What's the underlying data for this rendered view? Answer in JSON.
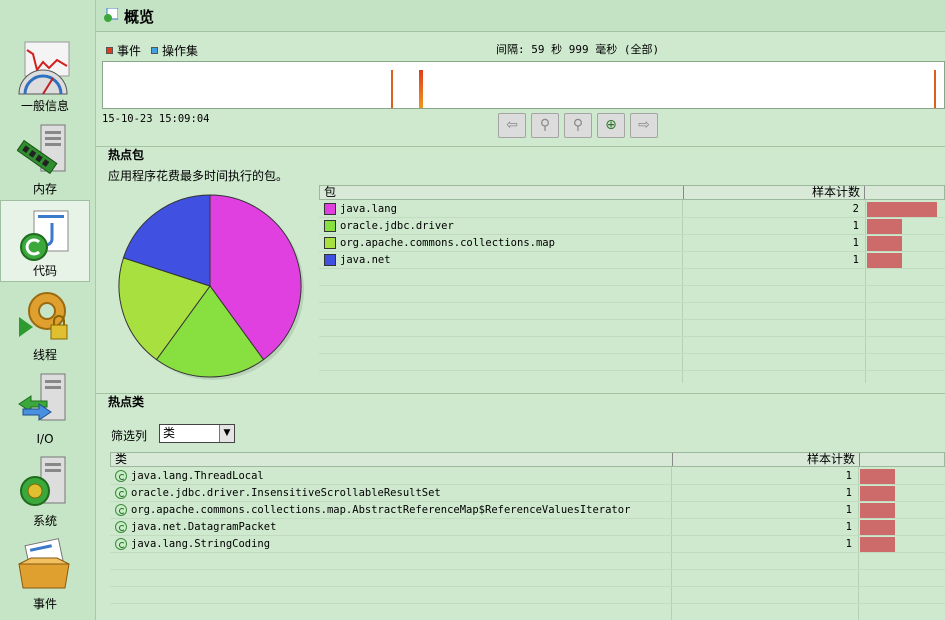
{
  "sidebar": {
    "items": [
      {
        "label": "一般信息"
      },
      {
        "label": "内存"
      },
      {
        "label": "代码"
      },
      {
        "label": "线程"
      },
      {
        "label": "I/O"
      },
      {
        "label": "系统"
      },
      {
        "label": "事件"
      }
    ]
  },
  "header": {
    "title": "概览"
  },
  "timeline": {
    "legend_events": "事件",
    "legend_operation_set": "操作集",
    "interval": "间隔: 59 秒 999 毫秒 (全部)",
    "timestamp": "15-10-23 15:09:04",
    "colors": {
      "events": "#e03c1c",
      "operation_set": "#3fa3e3",
      "ticks": "#e25c1c"
    }
  },
  "toolbar": {
    "icons": [
      "back-arrow-icon",
      "zoom-out-icon",
      "zoom-fit-icon",
      "zoom-in-icon",
      "forward-arrow-icon"
    ]
  },
  "hot_packages": {
    "title": "热点包",
    "description": "应用程序花费最多时间执行的包。",
    "col_package": "包",
    "col_count": "样本计数",
    "rows": [
      {
        "name": "java.lang",
        "count": "2",
        "color": "#e040e0",
        "share": 1.0
      },
      {
        "name": "oracle.jdbc.driver",
        "count": "1",
        "color": "#88e040",
        "share": 0.5
      },
      {
        "name": "org.apache.commons.collections.map",
        "count": "1",
        "color": "#a8e040",
        "share": 0.5
      },
      {
        "name": "java.net",
        "count": "1",
        "color": "#4050e0",
        "share": 0.5
      }
    ]
  },
  "hot_classes": {
    "title": "热点类",
    "filter_label": "筛选列",
    "filter_value": "类",
    "col_class": "类",
    "col_count": "样本计数",
    "rows": [
      {
        "name": "java.lang.ThreadLocal",
        "count": "1"
      },
      {
        "name": "oracle.jdbc.driver.InsensitiveScrollableResultSet",
        "count": "1"
      },
      {
        "name": "org.apache.commons.collections.map.AbstractReferenceMap$ReferenceValuesIterator",
        "count": "1"
      },
      {
        "name": "java.net.DatagramPacket",
        "count": "1"
      },
      {
        "name": "java.lang.StringCoding",
        "count": "1"
      }
    ]
  }
}
